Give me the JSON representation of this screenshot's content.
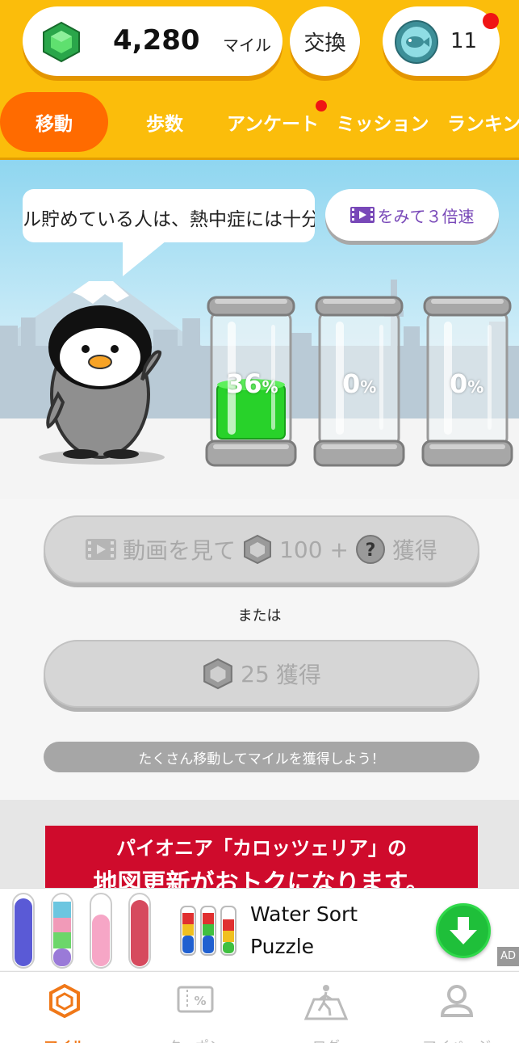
{
  "header": {
    "miles_value": "4,280",
    "miles_unit": "マイル",
    "exchange_label": "交換",
    "coin_count": "11"
  },
  "tabs": [
    {
      "label": "移動",
      "active": true
    },
    {
      "label": "歩数"
    },
    {
      "label": "アンケート",
      "badge": true
    },
    {
      "label": "ミッション"
    },
    {
      "label": "ランキング"
    }
  ],
  "scene": {
    "ticker_text": "ル貯めている人は、熱中症には十分",
    "speed_button_label": "をみて３倍速",
    "jars": [
      {
        "percent": "36",
        "fill": 0.36
      },
      {
        "percent": "0",
        "fill": 0
      },
      {
        "percent": "0",
        "fill": 0
      }
    ],
    "percent_sign": "%"
  },
  "actions": {
    "video_pre": "動画を見て",
    "video_amount": "100 +",
    "video_post": "獲得",
    "or_text": "または",
    "claim_amount": "25",
    "claim_label": "獲得",
    "hint": "たくさん移動してマイルを獲得しよう！"
  },
  "promo": {
    "line1": "パイオニア「カロッツェリア」の",
    "line2": "地図更新がおトクになります。"
  },
  "ad": {
    "title": "Water Sort Puzzle",
    "badge": "AD"
  },
  "bottom_nav": [
    {
      "label": "マイル",
      "icon": "gem-outline-icon",
      "active": true
    },
    {
      "label": "クーポン",
      "icon": "coupon-icon"
    },
    {
      "label": "ログ",
      "icon": "walking-log-icon"
    },
    {
      "label": "マイページ",
      "icon": "person-icon"
    }
  ],
  "colors": {
    "header": "#fbbd0b",
    "active_tab": "#ff6b00",
    "accent": "#f07818",
    "promo": "#cf0b2c"
  }
}
